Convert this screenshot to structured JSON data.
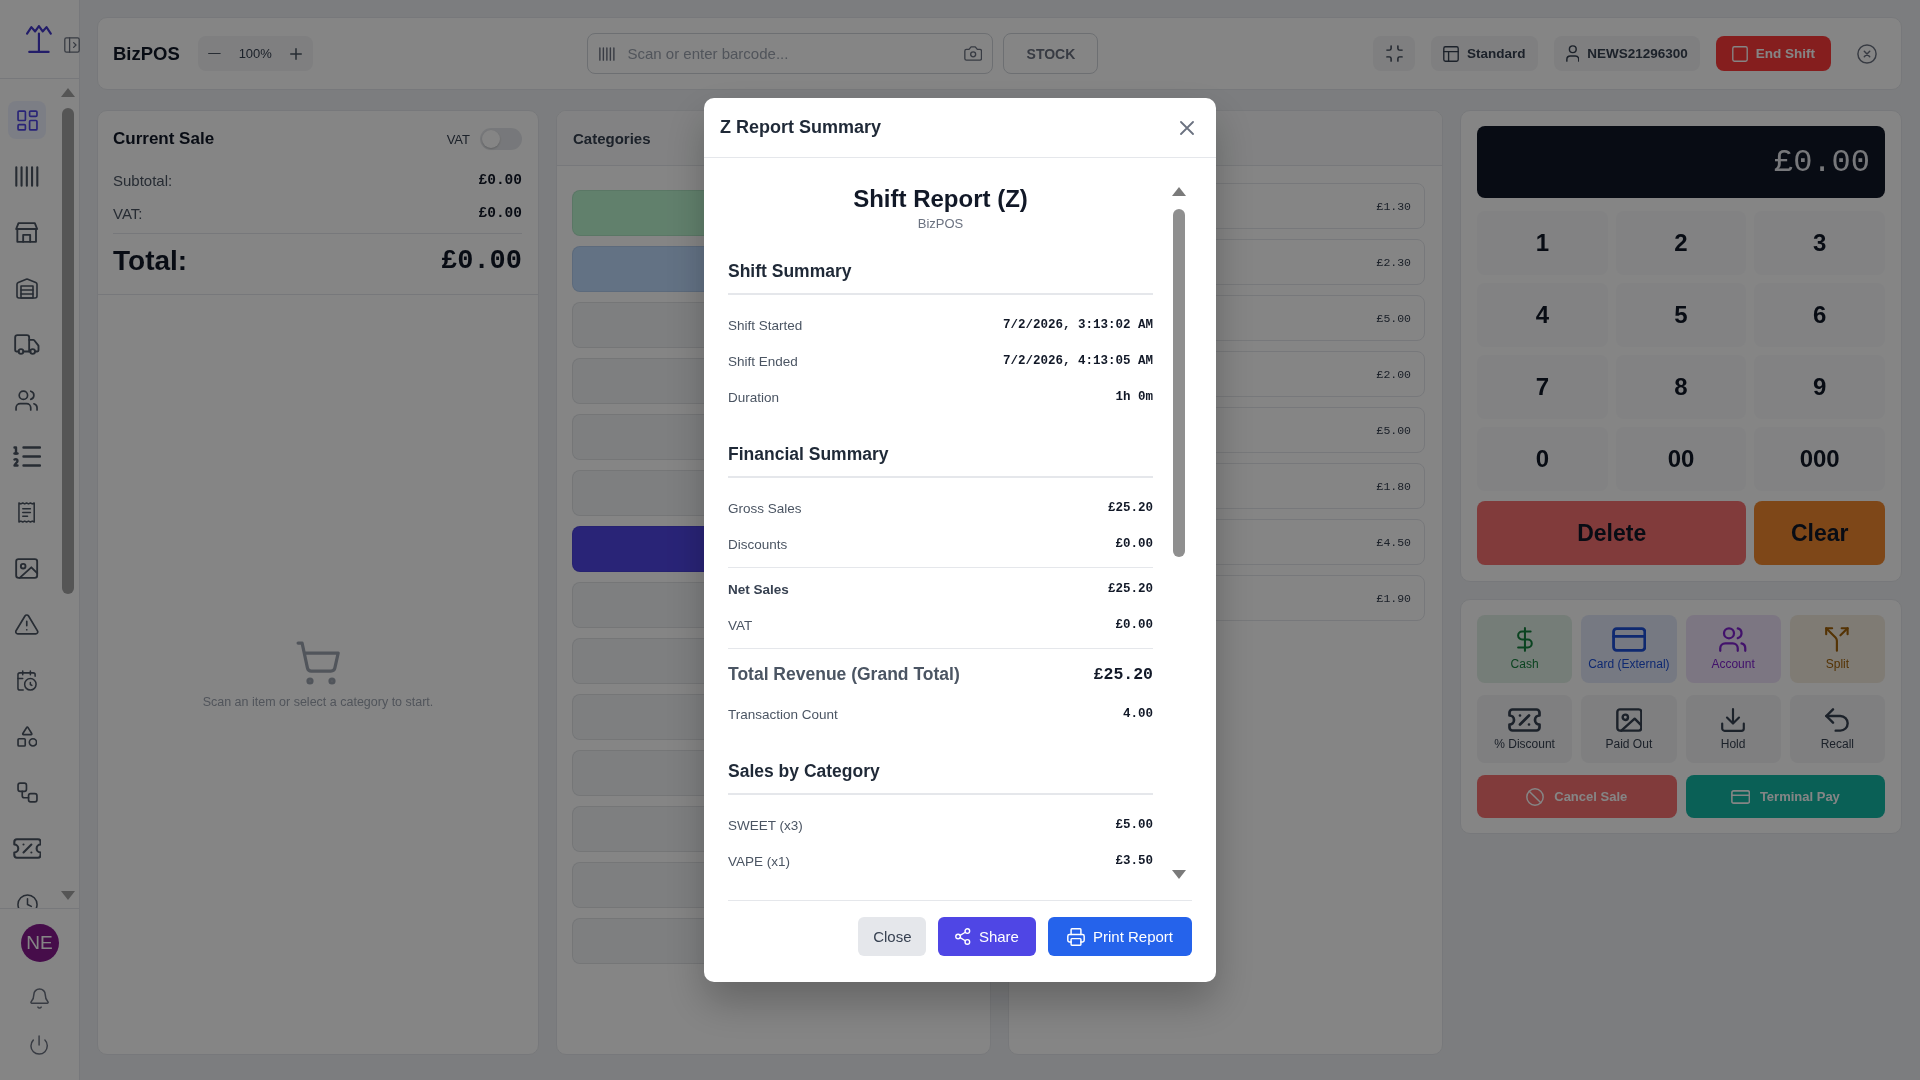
{
  "sidebar": {
    "nav_items": [
      {
        "selected": true
      },
      {
        "selected": false
      },
      {
        "selected": false
      },
      {
        "selected": false
      },
      {
        "selected": false
      },
      {
        "selected": false
      },
      {
        "selected": false
      },
      {
        "selected": false
      },
      {
        "selected": false
      },
      {
        "selected": false
      },
      {
        "selected": false
      },
      {
        "selected": false
      },
      {
        "selected": false
      },
      {
        "selected": false
      },
      {
        "selected": false
      }
    ],
    "avatar": "NE"
  },
  "topbar": {
    "app_name": "BizPOS",
    "zoom_level": "100%",
    "barcode_field": {
      "placeholder": "Scan or enter barcode..."
    },
    "stock_button": "STOCK",
    "layout_button": "Standard",
    "user_button": "NEWS21296300",
    "end_shift_button": "End Shift"
  },
  "current_sale": {
    "title": "Current Sale",
    "vat_toggle": {
      "label": "VAT",
      "on": false
    },
    "lines": [
      {
        "label": "Subtotal:",
        "value": "£0.00"
      },
      {
        "label": "VAT:",
        "value": "£0.00"
      }
    ],
    "total": {
      "label": "Total:",
      "value": "£0.00"
    },
    "empty_message": "Scan an item or select a category to start."
  },
  "categories": {
    "title": "Categories",
    "items": [
      {
        "color": "#61806c"
      },
      {
        "color": "#637284"
      },
      {
        "color": "#7e7f80"
      },
      {
        "color": "#7e7f80"
      },
      {
        "color": "#7e7f80"
      },
      {
        "color": "#7e7f80"
      },
      {
        "color": "#292477"
      },
      {
        "color": "#7e7f80"
      },
      {
        "color": "#7e7f80"
      },
      {
        "color": "#7e7f80"
      },
      {
        "color": "#7e7f80"
      },
      {
        "color": "#7e7f80"
      },
      {
        "color": "#7e7f80"
      },
      {
        "color": "#7e7f80"
      }
    ]
  },
  "products": {
    "items": [
      {
        "price": "£1.30"
      },
      {
        "price": "£2.30"
      },
      {
        "price": "£5.00"
      },
      {
        "price": "£2.00"
      },
      {
        "price": "£5.00"
      },
      {
        "price": "£1.80"
      },
      {
        "price": "£4.50"
      },
      {
        "price": "£1.90"
      }
    ]
  },
  "keypad": {
    "display": "£0.00",
    "keys": [
      "1",
      "2",
      "3",
      "4",
      "5",
      "6",
      "7",
      "8",
      "9",
      "0",
      "00",
      "000"
    ],
    "delete_button": "Delete",
    "clear_button": "Clear"
  },
  "payment": {
    "methods": [
      {
        "label": "Cash",
        "color": "#0b4320"
      },
      {
        "label": "Card (External)",
        "color": "#0f2970"
      },
      {
        "label": "Account",
        "color": "#42126b"
      },
      {
        "label": "Split",
        "color": "#543304"
      }
    ],
    "actions": [
      "% Discount",
      "Paid Out",
      "Hold",
      "Recall"
    ],
    "cancel_button": "Cancel Sale",
    "terminal_button": "Terminal Pay"
  },
  "modal": {
    "title": "Z Report Summary",
    "report": {
      "title": "Shift Report (Z)",
      "subtitle": "BizPOS",
      "sections": [
        {
          "heading": "Shift Summary",
          "groups": [
            [
              {
                "kind": "normal",
                "label": "Shift Started",
                "value": "7/2/2026, 3:13:02 AM"
              },
              {
                "kind": "normal",
                "label": "Shift Ended",
                "value": "7/2/2026, 4:13:05 AM"
              },
              {
                "kind": "normal",
                "label": "Duration",
                "value": "1h 0m"
              }
            ]
          ]
        },
        {
          "heading": "Financial Summary",
          "groups": [
            [
              {
                "kind": "normal",
                "label": "Gross Sales",
                "value": "£25.20"
              },
              {
                "kind": "normal",
                "label": "Discounts",
                "value": "£0.00"
              }
            ],
            [
              {
                "kind": "emphasis",
                "label": "Net Sales",
                "value": "£25.20"
              },
              {
                "kind": "normal",
                "label": "VAT",
                "value": "£0.00"
              }
            ],
            [
              {
                "kind": "grand",
                "label": "Total Revenue (Grand Total)",
                "value": "£25.20"
              },
              {
                "kind": "normal",
                "label": "Transaction Count",
                "value": "4.00"
              }
            ]
          ]
        },
        {
          "heading": "Sales by Category",
          "groups": [
            [
              {
                "kind": "normal",
                "label": "SWEET (x3)",
                "value": "£5.00"
              },
              {
                "kind": "normal",
                "label": "VAPE (x1)",
                "value": "£3.50"
              }
            ]
          ]
        }
      ]
    },
    "buttons": [
      {
        "kind": "secondary",
        "label": "Close"
      },
      {
        "kind": "share",
        "label": "Share"
      },
      {
        "kind": "print",
        "label": "Print Report"
      }
    ]
  }
}
